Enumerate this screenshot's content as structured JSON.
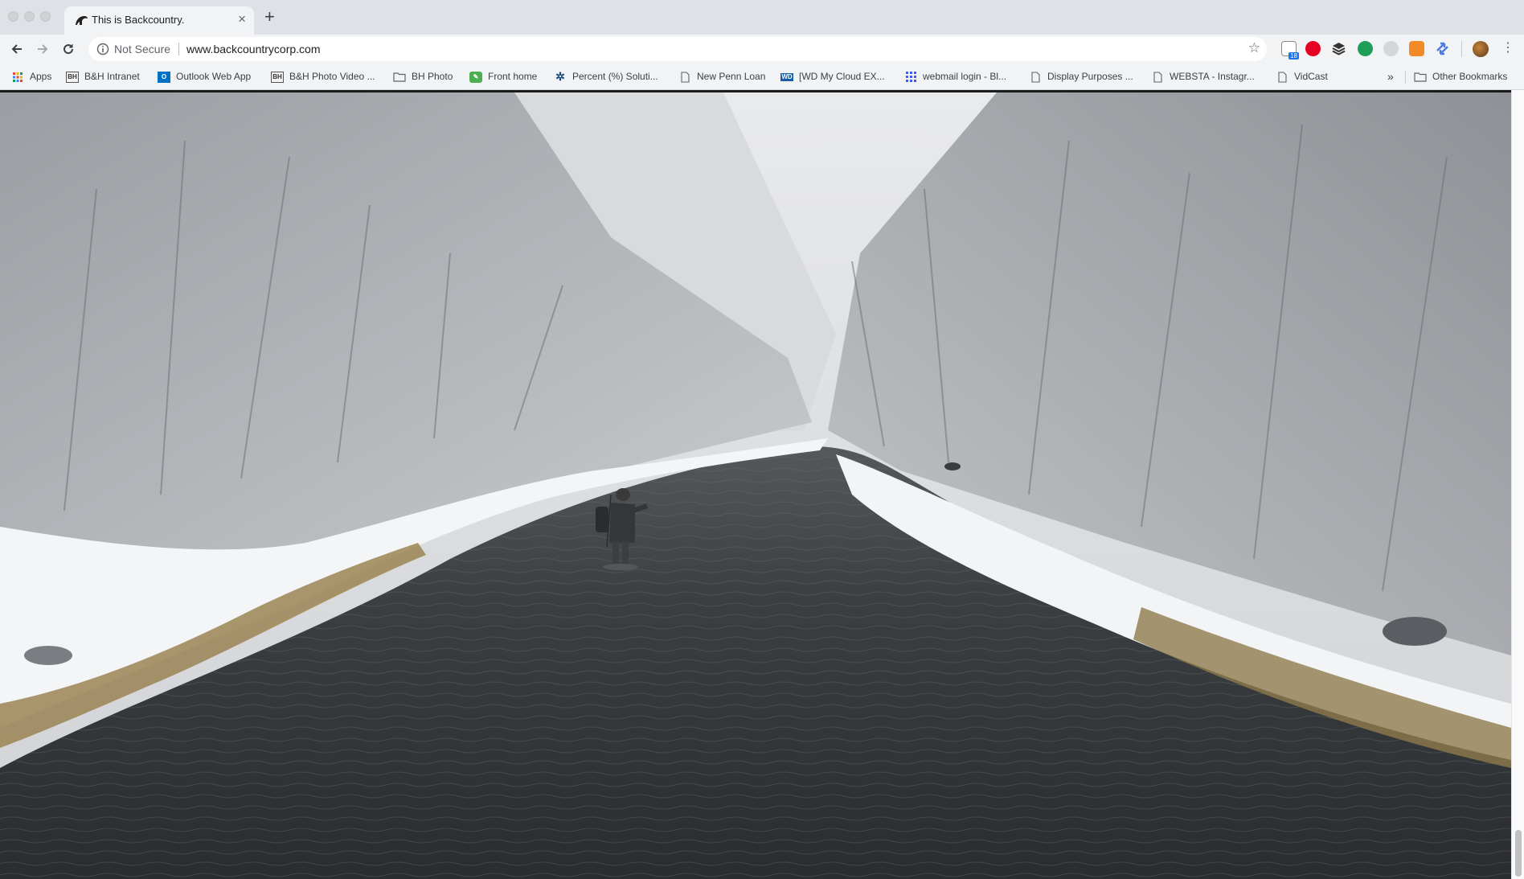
{
  "browser": {
    "tab": {
      "title": "This is Backcountry.",
      "close_icon": "×"
    },
    "new_tab_icon": "+",
    "address_bar": {
      "security_label": "Not Secure",
      "url": "www.backcountrycorp.com"
    },
    "bookmarks": [
      {
        "label": "Apps",
        "icon": "apps-grid-icon"
      },
      {
        "label": "B&H Intranet",
        "icon": "bh-icon"
      },
      {
        "label": "Outlook Web App",
        "icon": "outlook-icon"
      },
      {
        "label": "B&H Photo Video ...",
        "icon": "bh-icon"
      },
      {
        "label": "BH Photo",
        "icon": "folder-icon"
      },
      {
        "label": "Front home",
        "icon": "evernote-icon"
      },
      {
        "label": "Percent (%) Soluti...",
        "icon": "gear-icon"
      },
      {
        "label": "New Penn Loan",
        "icon": "page-icon"
      },
      {
        "label": "[WD My Cloud EX...",
        "icon": "wd-icon"
      },
      {
        "label": "webmail login - Bl...",
        "icon": "grid-icon"
      },
      {
        "label": "Display Purposes ...",
        "icon": "page-icon"
      },
      {
        "label": "WEBSTA - Instagr...",
        "icon": "page-icon"
      },
      {
        "label": "VidCast",
        "icon": "page-icon"
      }
    ],
    "overflow_label": "»",
    "other_bookmarks_label": "Other Bookmarks",
    "calendar_badge": "18"
  },
  "page": {
    "hero_image": "snowy-river-fly-fisherman-photo"
  },
  "colors": {
    "chrome_bg": "#dee1e6",
    "toolbar_bg": "#f1f3f4",
    "text": "#202124",
    "muted": "#5f6368"
  }
}
